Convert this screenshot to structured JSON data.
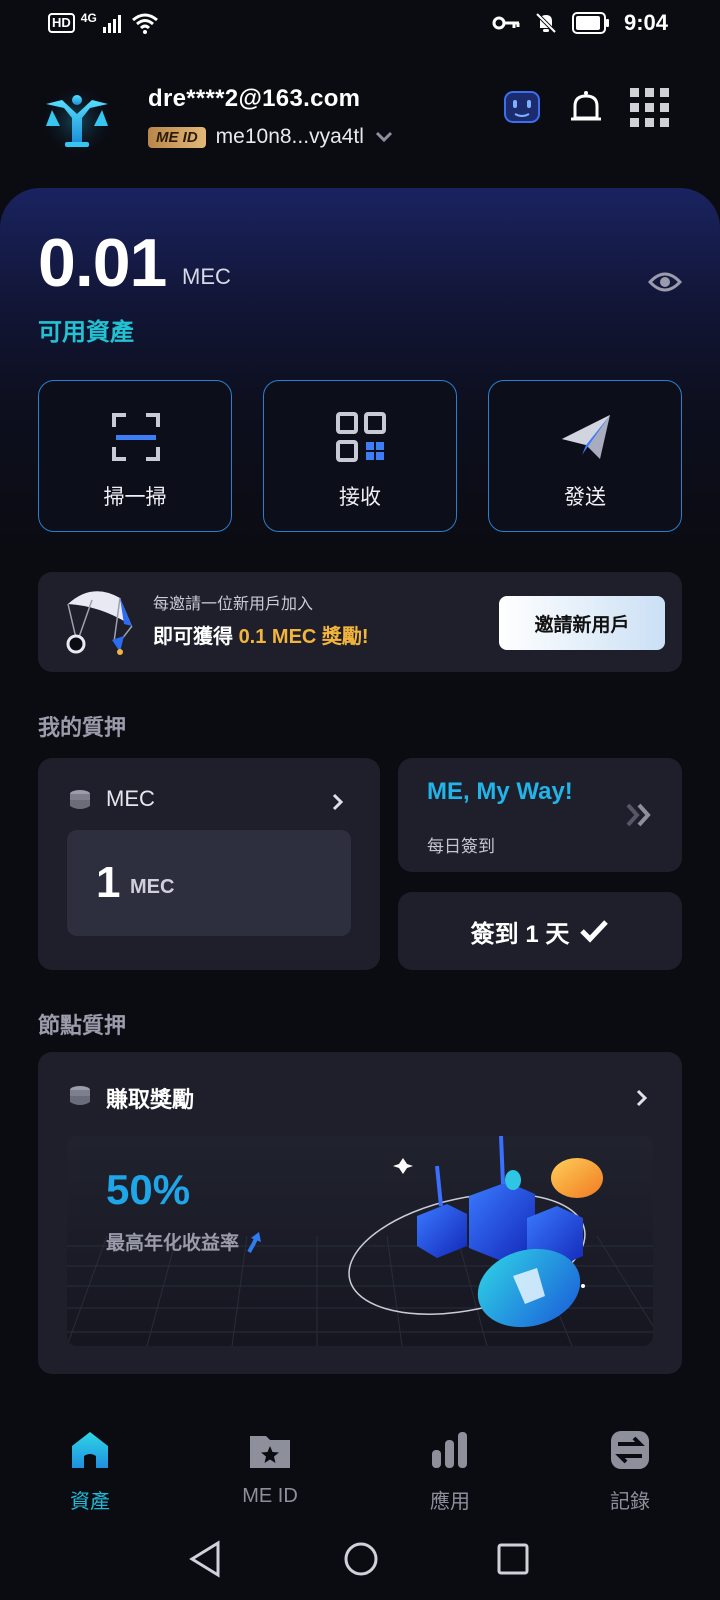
{
  "status_bar": {
    "hd": "HD",
    "network": "4G",
    "time": "9:04"
  },
  "header": {
    "email": "dre****2@163.com",
    "me_id_badge": "ME ID",
    "address": "me10n8...vya4tl"
  },
  "balance": {
    "amount": "0.01",
    "unit": "MEC",
    "label": "可用資產"
  },
  "actions": [
    {
      "label": "掃一掃",
      "icon": "scan-icon"
    },
    {
      "label": "接收",
      "icon": "qr-receive-icon"
    },
    {
      "label": "發送",
      "icon": "send-plane-icon"
    }
  ],
  "invite": {
    "line1": "每邀請一位新用戶加入",
    "line2_prefix": "即可獲得 ",
    "line2_highlight": "0.1 MEC 獎勵!",
    "button": "邀請新用戶"
  },
  "my_stake": {
    "title": "我的質押",
    "token": "MEC",
    "amount": "1",
    "amount_unit": "MEC"
  },
  "checkin": {
    "slogan": "ME, My Way!",
    "subtitle": "每日簽到",
    "button": "簽到 1 天"
  },
  "node_stake": {
    "title": "節點質押",
    "card_title": "賺取獎勵",
    "percent": "50%",
    "percent_label": "最高年化收益率"
  },
  "bottom_nav": [
    {
      "label": "資產",
      "active": true
    },
    {
      "label": "ME ID",
      "active": false
    },
    {
      "label": "應用",
      "active": false
    },
    {
      "label": "記錄",
      "active": false
    }
  ],
  "colors": {
    "accent": "#20b9d6",
    "gold": "#f2b53c",
    "card_bg": "#1e1f2b"
  }
}
